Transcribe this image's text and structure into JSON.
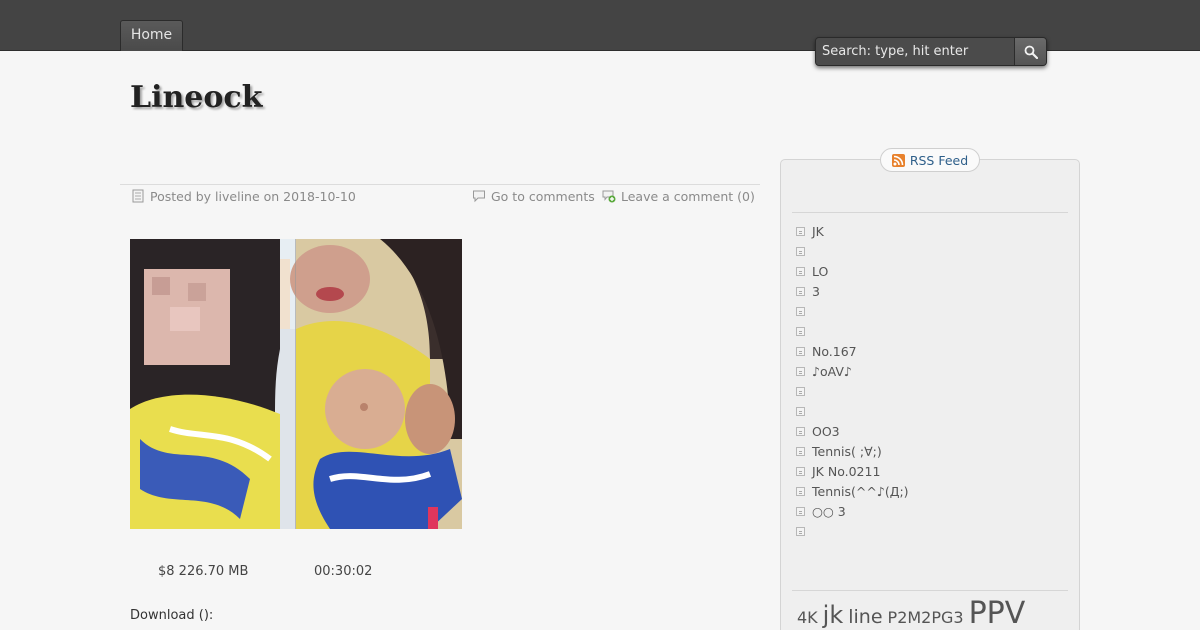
{
  "nav": {
    "home_label": "Home"
  },
  "search": {
    "placeholder": "Search: type, hit enter"
  },
  "site": {
    "title": "Lineock"
  },
  "post": {
    "posted_by": "Posted by liveline on 2018-10-10",
    "go_to_comments": "Go to comments",
    "leave_comment": "Leave a comment (0)",
    "size_text": "$8 226.70 MB",
    "duration_text": "00:30:02",
    "download_label": "Download ():"
  },
  "sidebar": {
    "rss_label": "RSS Feed",
    "items": [
      "JK",
      "",
      "LO",
      "3",
      "",
      "",
      " No.167",
      "♪oAV♪",
      "",
      "",
      "OO3",
      "Tennis( ;∀;)",
      "JK No.0211",
      "Tennis(^^♪(Д;)",
      "○○ 3",
      ""
    ],
    "tags": [
      "4K",
      "jk",
      "line",
      "P2M2PG3",
      "PPV"
    ]
  },
  "colors": {
    "topbar": "#444444",
    "link": "#2e5f8a",
    "rss": "#e8812c"
  }
}
